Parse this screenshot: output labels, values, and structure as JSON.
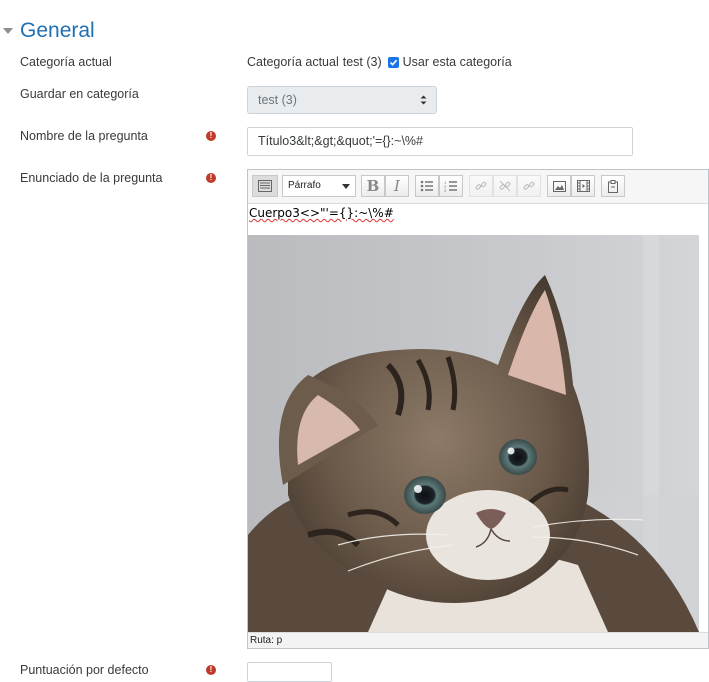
{
  "section": {
    "title": "General"
  },
  "fields": {
    "current_category": {
      "label": "Categoría actual",
      "prefix": "Categoría actual",
      "value": "test (3)",
      "checkbox_label": "Usar esta categoría",
      "checked": true
    },
    "save_in_category": {
      "label": "Guardar en categoría",
      "value": "test (3)"
    },
    "question_name": {
      "label": "Nombre de la pregunta",
      "value": "Título3&lt;&gt;&quot;'={}:~\\%#",
      "required": true
    },
    "question_text": {
      "label": "Enunciado de la pregunta",
      "required": true,
      "format_select": "Párrafo",
      "content_text": "Cuerpo3<>\"'={}:~\\%#",
      "image_subject": "tabby kitten",
      "path_label": "Ruta: p"
    },
    "default_mark": {
      "label": "Puntuación por defecto",
      "required": true
    }
  },
  "toolbar": {
    "buttons": [
      "toolbar-toggle-icon",
      "bold-icon",
      "italic-icon",
      "unordered-list-icon",
      "ordered-list-icon",
      "link-icon",
      "unlink-icon",
      "anchor-icon",
      "image-icon",
      "media-icon",
      "paste-icon"
    ]
  },
  "colors": {
    "accent": "#1f6fb5",
    "required": "#c0392b",
    "checkbox": "#1a73e8"
  }
}
